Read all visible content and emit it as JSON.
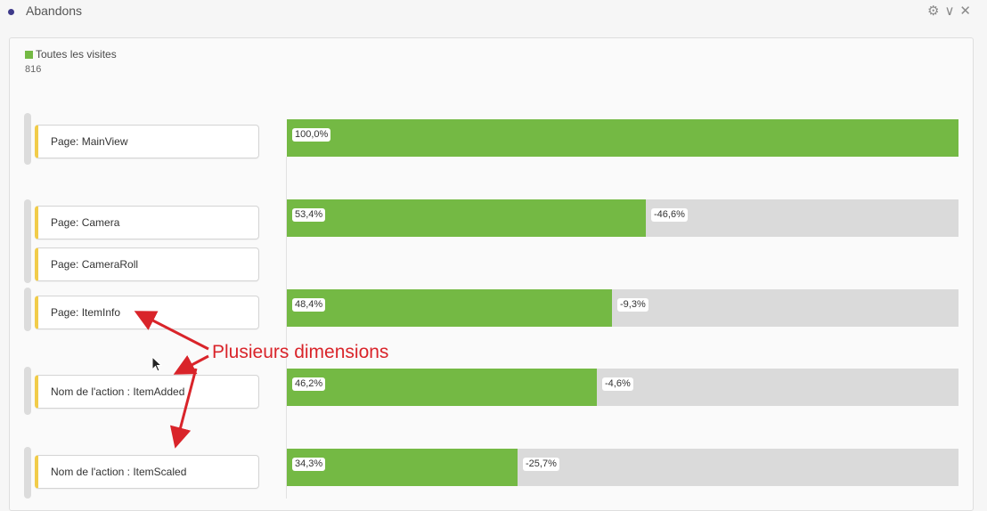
{
  "header": {
    "title": "Abandons",
    "icons": [
      "gear-icon",
      "chevron-down-icon",
      "close-icon"
    ]
  },
  "legend": {
    "label": "Toutes les visites",
    "total": "816",
    "color": "#74b944"
  },
  "annotation": {
    "text": "Plusieurs dimensions",
    "color": "#d9242a"
  },
  "chart_data": {
    "type": "bar",
    "orientation": "horizontal",
    "series_name": "Toutes les visites",
    "total": 816,
    "steps": [
      {
        "nodes": [
          "Page: MainView"
        ],
        "percent": 100.0,
        "percent_label": "100,0%",
        "dropoff_label": ""
      },
      {
        "nodes": [
          "Page: Camera",
          "Page: CameraRoll"
        ],
        "percent": 53.4,
        "percent_label": "53,4%",
        "dropoff_label": "-46,6%"
      },
      {
        "nodes": [
          "Page: ItemInfo"
        ],
        "percent": 48.4,
        "percent_label": "48,4%",
        "dropoff_label": "-9,3%"
      },
      {
        "nodes": [
          "Nom de l'action : ItemAdded"
        ],
        "percent": 46.2,
        "percent_label": "46,2%",
        "dropoff_label": "-4,6%"
      },
      {
        "nodes": [
          "Nom de l'action : ItemScaled"
        ],
        "percent": 34.3,
        "percent_label": "34,3%",
        "dropoff_label": "-25,7%"
      }
    ],
    "colors": {
      "fill": "#74b944",
      "remainder": "#dadada"
    }
  }
}
